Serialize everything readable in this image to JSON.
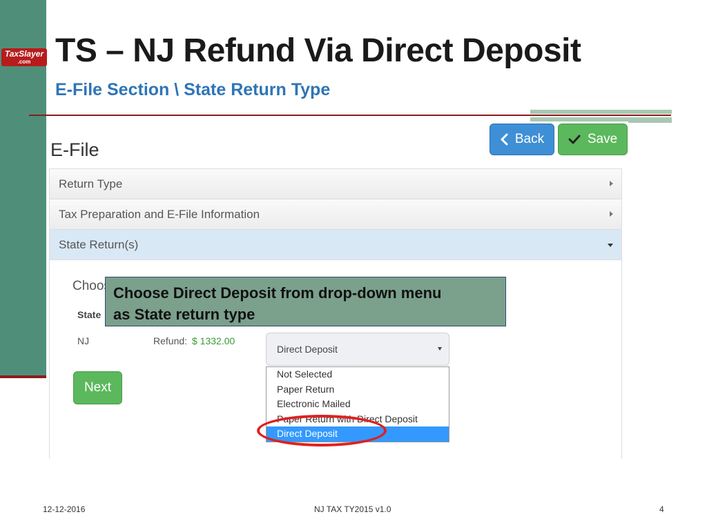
{
  "slide": {
    "title": "TS – NJ Refund Via Direct Deposit",
    "subtitle": "E-File Section \\ State Return Type",
    "logo": {
      "name": "TaxSlayer",
      "suffix": ".com"
    },
    "callout": {
      "line1": "Choose Direct Deposit from drop-down menu",
      "line2": "as State return type"
    },
    "footer": {
      "date": "12-12-2016",
      "center": "NJ TAX TY2015 v1.0",
      "page": "4"
    }
  },
  "app": {
    "page_title": "E-File",
    "toolbar": {
      "back_label": "Back",
      "save_label": "Save"
    },
    "accordion": [
      {
        "label": "Return Type",
        "state": "collapsed"
      },
      {
        "label": "Tax Preparation and E-File Information",
        "state": "collapsed"
      },
      {
        "label": "State Return(s)",
        "state": "expanded"
      }
    ],
    "state_section": {
      "choose_text": "Choose",
      "column_state": "State",
      "row": {
        "state": "NJ",
        "refund_label": "Refund:",
        "refund_value": "$ 1332.00"
      },
      "select": {
        "value": "Direct Deposit",
        "options": [
          "Not Selected",
          "Paper Return",
          "Electronic Mailed",
          "Paper Return with Direct Deposit",
          "Direct Deposit"
        ],
        "selected_index": 4
      },
      "next_label": "Next"
    }
  },
  "colors": {
    "accent_blue": "#3f8fd6",
    "accent_green": "#5cb85c",
    "highlight_red": "#e02020",
    "slide_green": "#4f8f79",
    "title_blue": "#2e75b6"
  }
}
